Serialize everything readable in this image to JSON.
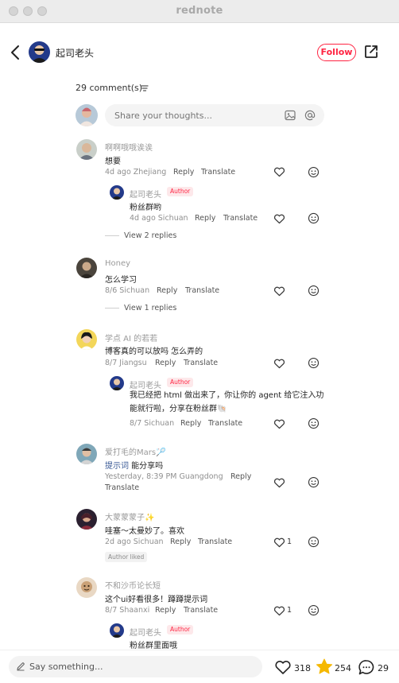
{
  "app": {
    "title": "rednote"
  },
  "header": {
    "author": "起司老头",
    "follow_label": "Follow"
  },
  "comments_header": {
    "count_label": "29 comment(s)"
  },
  "input": {
    "placeholder": "Share your thoughts..."
  },
  "comments": [
    {
      "user": "啊啊哦哦诶诶",
      "text": "想要",
      "meta": "4d ago Zhejiang",
      "reply": "Reply",
      "translate": "Translate",
      "replies": [
        {
          "user": "起司老头",
          "badge": "Author",
          "text": "粉丝群哟",
          "meta": "4d ago Sichuan"
        }
      ],
      "view_replies": "View 2 replies"
    },
    {
      "user": "Honey",
      "text": "怎么学习",
      "meta": "8/6 Sichuan",
      "view_replies": "View 1 replies"
    },
    {
      "user": "学点 AI 的若若",
      "text": "博客真的可以放吗 怎么弄的",
      "meta": "8/7 Jiangsu",
      "replies": [
        {
          "user": "起司老头",
          "badge": "Author",
          "text": "我已经把 html 做出来了，你让你的 agent 给它注入功能就行啦，分享在粉丝群🐚",
          "meta": "8/7 Sichuan"
        }
      ]
    },
    {
      "user": "爱打毛的Mars🏸",
      "link_text": "提示词",
      "text": " 能分享吗",
      "meta": "Yesterday, 8:39 PM Guangdong"
    },
    {
      "user": "大蒙蒙蒙子✨",
      "text": "哇塞～太曼妙了。喜欢",
      "meta": "2d ago Sichuan",
      "likes": "1",
      "liked_badge": "Author liked"
    },
    {
      "user": "不和沙币论长短",
      "text": "这个ui好看很多！蹲蹲提示词",
      "meta": "8/7 Shaanxi",
      "likes": "1",
      "replies": [
        {
          "user": "起司老头",
          "badge": "Author",
          "text": "粉丝群里面哦"
        }
      ]
    }
  ],
  "bottom": {
    "say_placeholder": "Say something...",
    "likes": "318",
    "collects": "254",
    "comments": "29"
  },
  "colors": {
    "accent": "#ff2442",
    "star": "#f5b800"
  }
}
